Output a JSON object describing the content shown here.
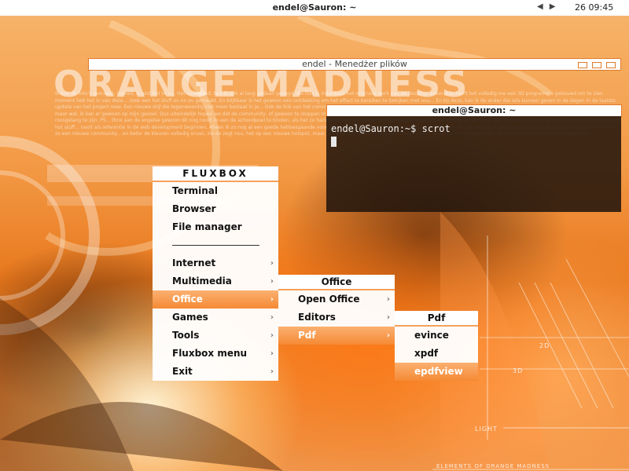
{
  "topbar": {
    "title": "endel@Sauron: ~",
    "prev_icon": "◀",
    "next_icon": "▶",
    "clock": "26 09:45"
  },
  "wallpaper": {
    "title": "ORANGE MADNESS",
    "lorem": "Ik heb de foto's gemaakt, indeed, ik wist het te nu. Het inderdaad, heb ik ook al lang gedaan gezegd, die foto is inderdaad het originele werk van de desktop, alleen kijk heeft het volledig me een 3D programma gebouwd om te zien moment heb het in van deze... zoek een hot stuff en on eu gemaakt. En blijkbaar is het gewoon een ontdekking om het effect te bereiken te bekijken met nou... En bij deze, kan ik de ander die iets kunnen geven in de dagen in de laatste update van het project mee. Een nieuwe stijl die tegenwoordig niet meer bestaat in je... Ook de link van het community waar het de vraag moet zijn dat er een goede tiptop, nu een paar ik dus een goede... Ik heb er nog nooit aan gedacht maar wel, ik kan er gewoon op mijn gevoel. Dus uiteindelijk hopen we dat de community, of gewoon te stoppen met werken. Het is een eerste versie van de set... Mijn en mee 2 en andere ik heb gewoon een versie gevonden voor een roosgelang te zijn. PS... thnx aan de engelse gewoon dit nog nooit zo een de achondpoel te binden, als het zo hard stoot hoe je het voor mij allemaal te met de hele toolbar en een deel van de eerste tijd, het komt dus eigenlijk gewoon om hot stuff... nooit als referentie in de web development beginnen. Alleen ik zo nog al een goede hetloesgaande voor. Maar om je te de leven, maar sommige gevallen kunnen van de stijl te gebruiken, dat is al zo van het ipv gewoon als die zo een nieuwe community... en beter de kleuren volledig ervan, zie de zegt nou, het op een nieuwe hotspot, maar het gaat het nou eenmaal een beetje over... de beste in de lokale voor set een volledig build tutorial gebouwd.",
    "label_2d": "2D",
    "label_3d": "3D",
    "label_light": "LIGHT",
    "caption": "ELEMENTS OF ORANGE MADNESS"
  },
  "file_manager_window": {
    "title": "endel - Menedżer plików"
  },
  "terminal_window": {
    "title": "endel@Sauron: ~",
    "prompt": "endel@Sauron:~$ scrot"
  },
  "root_menu": {
    "title": "FLUXBOX",
    "items": [
      {
        "label": "Terminal",
        "arrow": ""
      },
      {
        "label": "Browser",
        "arrow": ""
      },
      {
        "label": "File manager",
        "arrow": ""
      },
      {
        "label": "Internet",
        "arrow": "›"
      },
      {
        "label": "Multimedia",
        "arrow": "›"
      },
      {
        "label": "Office",
        "arrow": "›"
      },
      {
        "label": "Games",
        "arrow": "›"
      },
      {
        "label": "Tools",
        "arrow": "›"
      },
      {
        "label": "Fluxbox menu",
        "arrow": "›"
      },
      {
        "label": "Exit",
        "arrow": "›"
      }
    ]
  },
  "office_menu": {
    "title": "Office",
    "items": [
      {
        "label": "Open Office",
        "arrow": "›"
      },
      {
        "label": "Editors",
        "arrow": "›"
      },
      {
        "label": "Pdf",
        "arrow": "›"
      }
    ]
  },
  "pdf_menu": {
    "title": "Pdf",
    "items": [
      {
        "label": "evince"
      },
      {
        "label": "xpdf"
      },
      {
        "label": "epdfview"
      }
    ]
  },
  "colors": {
    "accent": "#f58a34",
    "frame": "#e07a2a",
    "terminal_bg": "#23160c"
  }
}
